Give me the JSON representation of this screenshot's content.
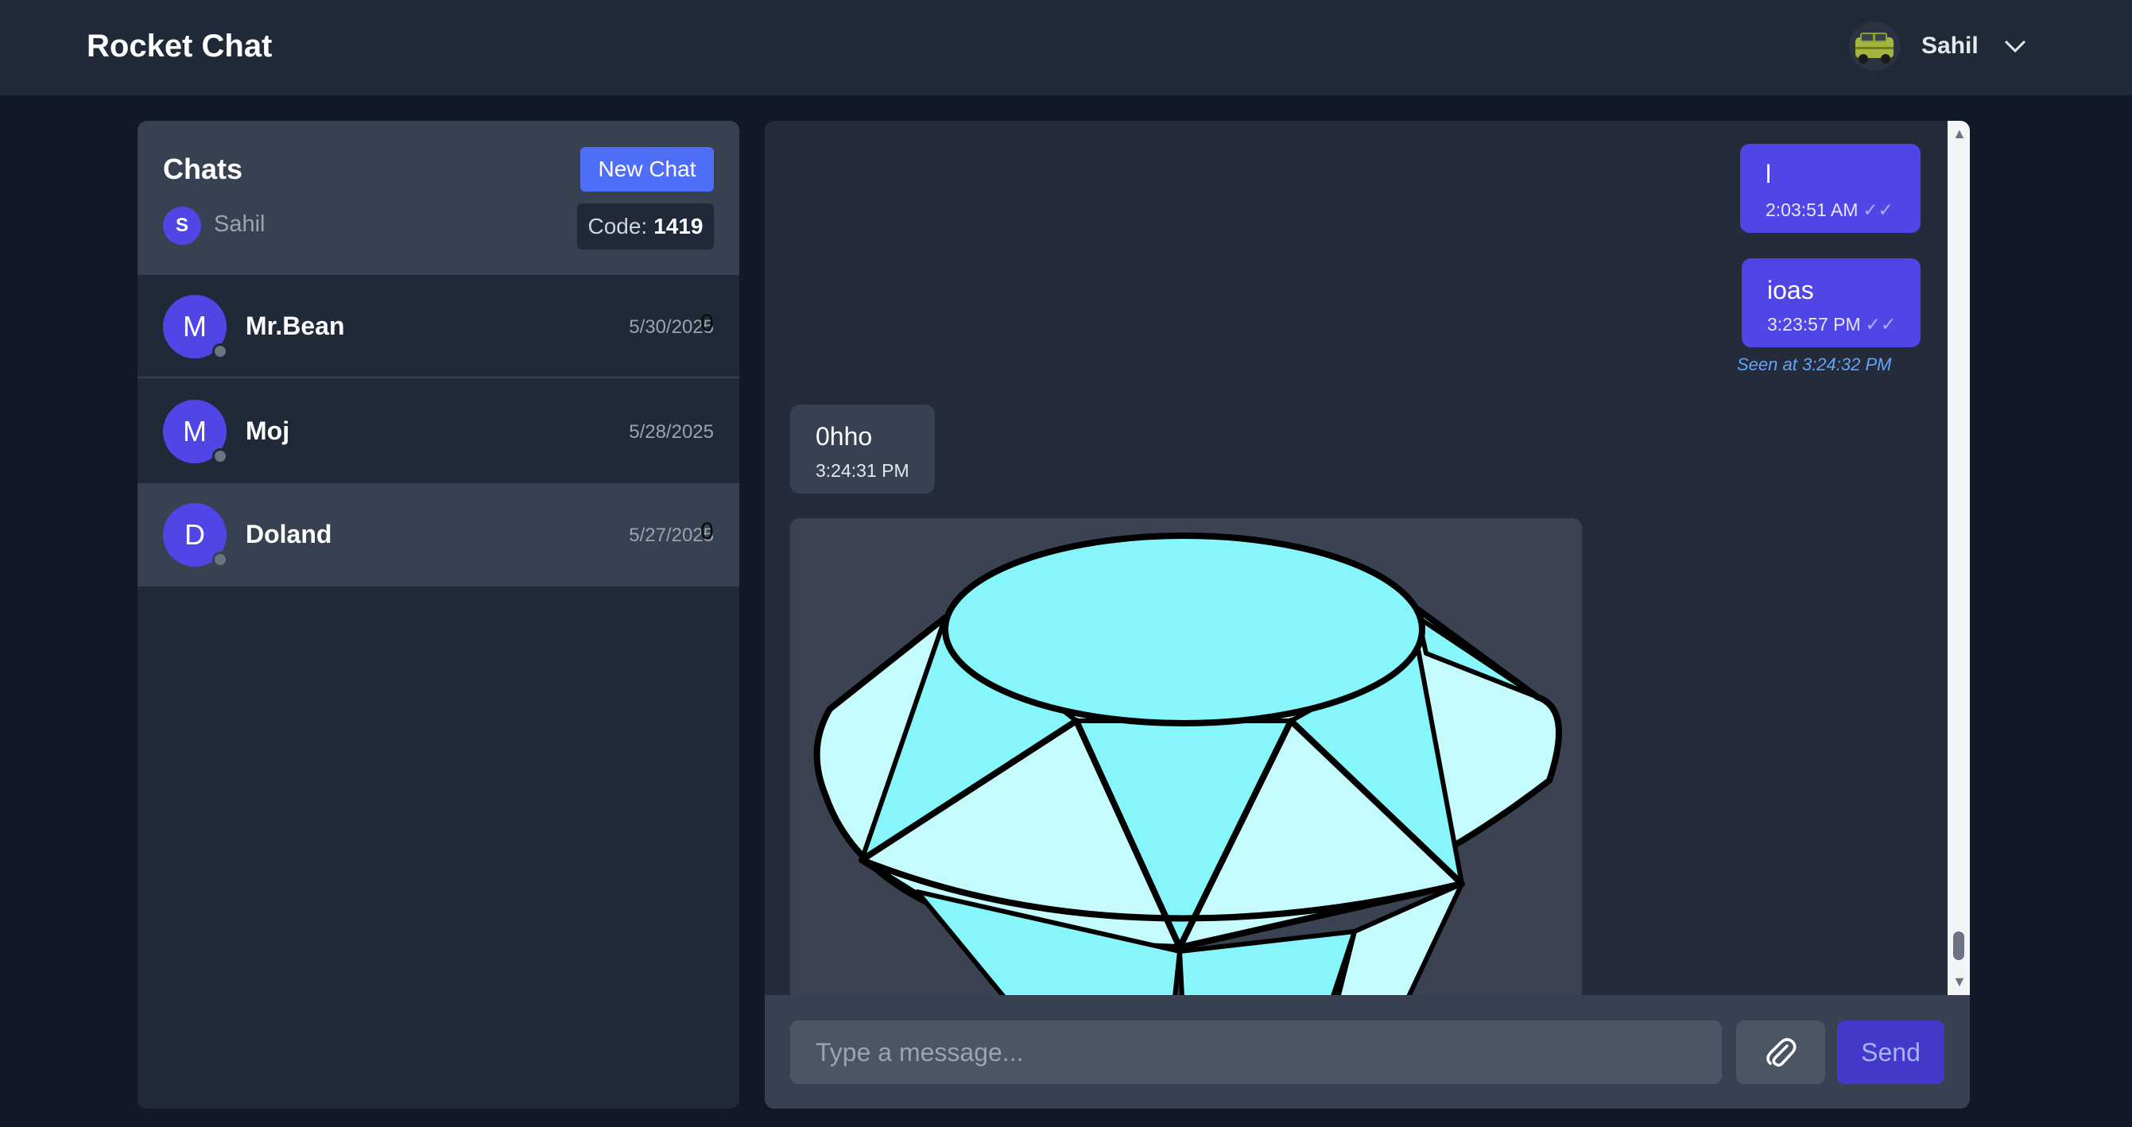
{
  "header": {
    "app_title": "Rocket Chat",
    "user_name": "Sahil",
    "avatar_icon": "car-avatar-icon",
    "menu_icon": "chevron-down-icon"
  },
  "sidebar": {
    "title": "Chats",
    "new_chat_label": "New Chat",
    "me_initial": "S",
    "me_name": "Sahil",
    "code_label": "Code:",
    "code_value": "1419",
    "chats": [
      {
        "initial": "M",
        "name": "Mr.Bean",
        "date": "5/30/2025",
        "count": "0"
      },
      {
        "initial": "M",
        "name": "Moj",
        "date": "5/28/2025",
        "count": ""
      },
      {
        "initial": "D",
        "name": "Doland",
        "date": "5/27/2025",
        "count": "0"
      }
    ]
  },
  "messages": [
    {
      "direction": "out",
      "text": "l",
      "time": "2:03:51 AM",
      "ticks": "✓✓"
    },
    {
      "direction": "out",
      "text": "ioas",
      "time": "3:23:57 PM",
      "ticks": "✓✓"
    },
    {
      "direction": "in",
      "text": "0hho",
      "time": "3:24:31 PM"
    },
    {
      "direction": "in",
      "type": "image",
      "image_icon": "diamond-image"
    }
  ],
  "seen_text": "Seen at 3:24:32 PM",
  "composer": {
    "placeholder": "Type a message...",
    "attach_icon": "paperclip-icon",
    "send_label": "Send"
  },
  "colors": {
    "background": "#111827",
    "panel": "#1f2937",
    "accent": "#4f46e5",
    "button": "#4f6ef7",
    "seen": "#60a5fa"
  }
}
